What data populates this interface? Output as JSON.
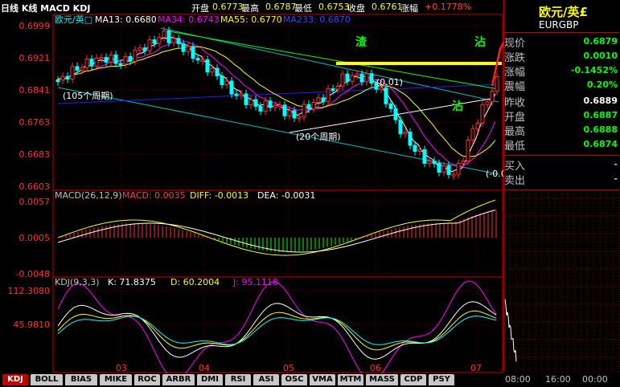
{
  "header": {
    "chart_title": "日线 K线 MACD KDJ",
    "open_label": "开盘",
    "open_value": "0.6773",
    "high_label": "最高",
    "high_value": "0.6787",
    "low_label": "最低",
    "low_value": "0.6753",
    "close_label": "收盘",
    "close_value": "0.6761",
    "change_label": "涨幅",
    "change_value": "+0.1778%"
  },
  "ma_legend": {
    "name": "欧元/英□",
    "ma13": "MA13: 0.6680",
    "ma34": "MA34: 0.6743",
    "ma55": "MA55: 0.6770",
    "ma233": "MA233: 0.6870"
  },
  "price_axis": [
    "0.6999",
    "0.6921",
    "0.6841",
    "0.6763",
    "0.6683",
    "0.6603"
  ],
  "macd_legend": {
    "title": "MACD(26,12,9)",
    "macd": "MACD: 0.0035",
    "diff": "DIFF: -0.0013",
    "dea": "DEA: -0.0031"
  },
  "macd_axis": [
    "0.0057",
    "0.0005",
    "-0.0048"
  ],
  "kdj_legend": {
    "title": "KDJ(9,3,3)",
    "k": "K: 71.8375",
    "d": "D: 60.2004",
    "j": "J: 95.1118"
  },
  "kdj_axis": [
    "112.3080",
    "45.9810"
  ],
  "month_axis": [
    "03",
    "04",
    "05",
    "06",
    "07"
  ],
  "annotations": {
    "period_105": "(105个周期)",
    "period_20": "(20个周期)",
    "val_001": "(0.01)",
    "val_neg": "(-0.0",
    "zha_1": "渣",
    "zhan_1": "沾",
    "zhan_2": "沾",
    "zha_2": "渣",
    "zha_3": "渣"
  },
  "quote_panel": {
    "title": "欧元/英£",
    "symbol": "EURGBP",
    "rows": [
      {
        "label": "现价",
        "value": "0.6879",
        "color": "#00ff00"
      },
      {
        "label": "涨跌",
        "value": "0.0010",
        "color": "#00ff00"
      },
      {
        "label": "涨幅",
        "value": "-0.1452%",
        "color": "#00ff00"
      },
      {
        "label": "震幅",
        "value": "0.20%",
        "color": "#00ff00"
      },
      {
        "label": "昨收",
        "value": "0.6889",
        "color": "#ffffff"
      },
      {
        "label": "开盘",
        "value": "0.6887",
        "color": "#00ff00"
      },
      {
        "label": "最高",
        "value": "0.6888",
        "color": "#00ff00"
      },
      {
        "label": "最低",
        "value": "0.6874",
        "color": "#00ff00"
      },
      {
        "label": "买入",
        "value": "-",
        "color": "#c0c0c0"
      },
      {
        "label": "卖出",
        "value": "-",
        "color": "#c0c0c0"
      }
    ]
  },
  "tabs": [
    "KDJ",
    "BOLL",
    "BIAS",
    "MIKE",
    "ROC",
    "ARBR",
    "DMI",
    "RSI",
    "ASI",
    "OSC",
    "VMA",
    "MTM",
    "MASS",
    "CDP",
    "PSY"
  ],
  "time_axis": [
    "08:00",
    "16:00",
    "00:00"
  ],
  "colors": {
    "up": "#ff3030",
    "down": "#00ffff",
    "ma13": "#ffffff",
    "ma34": "#ff00ff",
    "ma55": "#ffff00",
    "ma233": "#4040ff",
    "grid": "#800000",
    "axis": "#c00000"
  }
}
